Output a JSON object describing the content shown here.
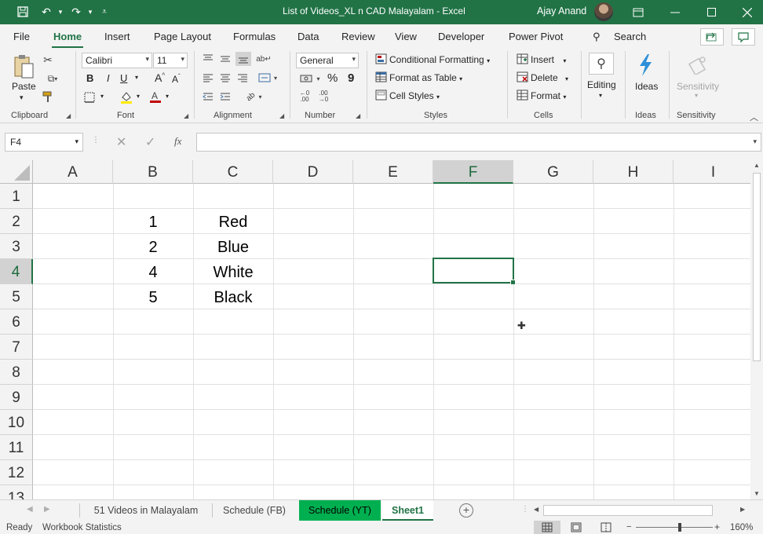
{
  "titlebar": {
    "title": "List of Videos_XL n CAD Malayalam  -  Excel",
    "user": "Ajay Anand",
    "quick_access": [
      "save-icon",
      "undo-icon",
      "redo-icon",
      "customize-icon"
    ],
    "window_buttons": [
      "ribbon-display-icon",
      "minimize-icon",
      "maximize-icon",
      "close-icon"
    ]
  },
  "tabs": [
    "File",
    "Home",
    "Insert",
    "Page Layout",
    "Formulas",
    "Data",
    "Review",
    "View",
    "Developer",
    "Power Pivot"
  ],
  "active_tab": "Home",
  "search_label": "Search",
  "ribbon": {
    "clipboard": {
      "paste": "Paste",
      "label": "Clipboard"
    },
    "font": {
      "name": "Calibri",
      "size": "11",
      "label": "Font",
      "bold": "B",
      "italic": "I",
      "underline": "U"
    },
    "alignment": {
      "label": "Alignment"
    },
    "number": {
      "format": "General",
      "label": "Number",
      "percent": "%",
      "comma": "9"
    },
    "styles": {
      "conditional": "Conditional Formatting",
      "table": "Format as Table",
      "cell": "Cell Styles",
      "label": "Styles"
    },
    "cells": {
      "insert": "Insert",
      "delete": "Delete",
      "format": "Format",
      "label": "Cells"
    },
    "editing": {
      "label": "Editing"
    },
    "ideas": {
      "button": "Ideas",
      "label": "Ideas"
    },
    "sensitivity": {
      "button": "Sensitivity",
      "label": "Sensitivity"
    }
  },
  "formula_bar": {
    "name_box": "F4",
    "fx": "fx",
    "content": ""
  },
  "grid": {
    "columns": [
      "A",
      "B",
      "C",
      "D",
      "E",
      "F",
      "G",
      "H",
      "I"
    ],
    "rows": [
      "1",
      "2",
      "3",
      "4",
      "5",
      "6",
      "7",
      "8",
      "9",
      "10",
      "11",
      "12",
      "13"
    ],
    "selected_cell": "F4",
    "cells": [
      {
        "ref": "B2",
        "value": "1"
      },
      {
        "ref": "C2",
        "value": "Red"
      },
      {
        "ref": "B3",
        "value": "2"
      },
      {
        "ref": "C3",
        "value": "Blue"
      },
      {
        "ref": "B4",
        "value": "4"
      },
      {
        "ref": "C4",
        "value": "White"
      },
      {
        "ref": "B5",
        "value": "5"
      },
      {
        "ref": "C5",
        "value": "Black"
      }
    ]
  },
  "sheets": {
    "tabs": [
      "51 Videos in Malayalam",
      "Schedule (FB)",
      "Schedule (YT)",
      "Sheet1"
    ],
    "active": "Sheet1",
    "colored": "Schedule (YT)",
    "colored_color": "#00b050"
  },
  "status": {
    "ready": "Ready",
    "stats": "Workbook Statistics",
    "zoom": "160%"
  },
  "colors": {
    "accent": "#217346",
    "tab_green": "#00b050"
  }
}
